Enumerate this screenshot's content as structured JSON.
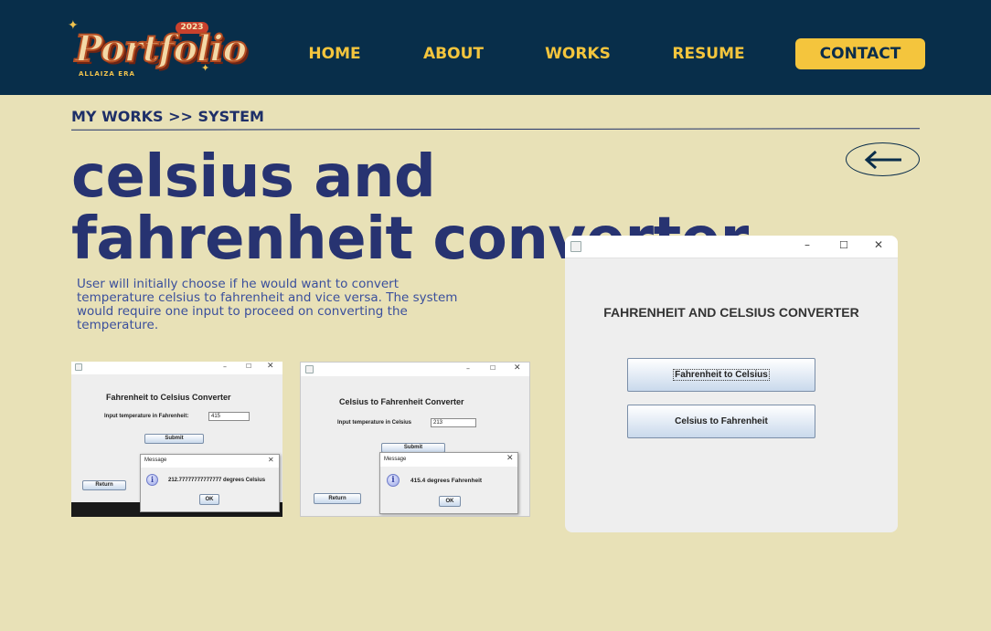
{
  "logo": {
    "year": "2023",
    "word": "Portfolio",
    "sub": "ALLAIZA ERA"
  },
  "nav": {
    "home": "HOME",
    "about": "ABOUT",
    "works": "WORKS",
    "resume": "RESUME",
    "contact": "CONTACT"
  },
  "breadcrumb": "MY WORKS >> SYSTEM",
  "title": "celsius and fahrenheit converter",
  "description": "User will initially choose if he would want to convert temperature celsius to fahrenheit and vice versa. The system would require one input to proceed on converting the temperature.",
  "shot1": {
    "heading": "Fahrenheit to Celsius Converter",
    "label": "Input temperature in Fahrenheit:",
    "value": "415",
    "submit": "Submit",
    "return": "Return",
    "msg_title": "Message",
    "msg_text": "212.77777777777777 degrees Celsius",
    "ok": "OK"
  },
  "shot2": {
    "heading": "Celsius to Fahrenheit Converter",
    "label": "Input temperature in Celsius",
    "value": "213",
    "submit": "Submit",
    "return": "Return",
    "msg_title": "Message",
    "msg_text": "415.4 degrees Fahrenheit",
    "ok": "OK"
  },
  "shot3": {
    "heading": "FAHRENHEIT AND CELSIUS CONVERTER",
    "btn_f2c": "Fahrenheit to Celsius",
    "btn_c2f": "Celsius to Fahrenheit"
  },
  "colors": {
    "header_bg": "#082e4a",
    "page_bg": "#e8e1b7",
    "accent": "#f4c53d",
    "title": "#273371"
  }
}
